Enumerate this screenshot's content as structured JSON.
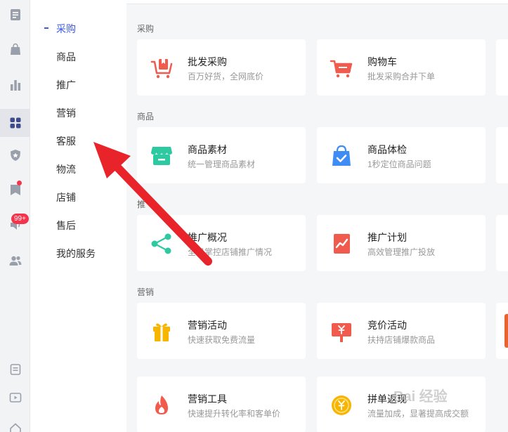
{
  "rail": {
    "icons": [
      "document-icon",
      "bag-icon",
      "bar-chart-icon",
      "apps-icon",
      "shield-star-icon",
      "bookmark-icon",
      "speaker-icon",
      "users-icon",
      "ticket-icon",
      "video-icon",
      "home-icon"
    ],
    "badge": "99+"
  },
  "submenu": {
    "items": [
      "采购",
      "商品",
      "推广",
      "营销",
      "客服",
      "物流",
      "店铺",
      "售后",
      "我的服务"
    ],
    "active": "采购"
  },
  "sections": {
    "purchase": "采购",
    "goods": "商品",
    "promo": "推",
    "marketing": "营销"
  },
  "cards": {
    "wholesale": {
      "title": "批发采购",
      "desc": "百万好货，全网底价"
    },
    "cart": {
      "title": "购物车",
      "desc": "批发采购合并下单"
    },
    "material": {
      "title": "商品素材",
      "desc": "统一管理商品素材"
    },
    "checkup": {
      "title": "商品体检",
      "desc": "1秒定位商品问题"
    },
    "overview": {
      "title": "推广概况",
      "desc": "全局掌控店铺推广情况"
    },
    "plan": {
      "title": "推广计划",
      "desc": "高效管理推广投放"
    },
    "activity": {
      "title": "营销活动",
      "desc": "快速获取免费流量"
    },
    "bidding": {
      "title": "竞价活动",
      "desc": "扶持店铺爆款商品"
    },
    "tools": {
      "title": "营销工具",
      "desc": "快速提升转化率和客单价"
    },
    "groupbuy": {
      "title": "拼单返现",
      "desc": "流量加成，显著提高成交额"
    }
  },
  "watermark": "Bai 经验",
  "colors": {
    "accent": "#3d5ae0",
    "red": "#f15b4d",
    "green": "#2dc9a0",
    "blue": "#3f8cf5",
    "yellow": "#f7b500",
    "arrow": "#e8232a"
  }
}
